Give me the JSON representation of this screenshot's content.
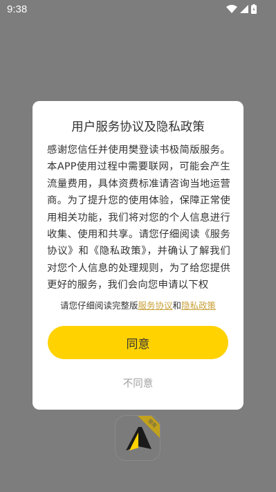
{
  "status_bar": {
    "time": "9:38",
    "icons": [
      "wifi-icon",
      "cell-signal-icon",
      "battery-icon"
    ]
  },
  "dialog": {
    "title": "用户服务协议及隐私政策",
    "body": "感谢您信任并使用樊登读书极简版服务。本APP使用过程中需要联网，可能会产生流量费用，具体资费标准请咨询当地运营商。为了提升您的使用体验，保障正常使用相关功能，我们将对您的个人信息进行收集、使用和共享。请您仔细阅读《服务协议》和《隐私政策》，并确认了解我们对您个人信息的处理规则，为了给您提供更好的服务，我们会向您申请以下权",
    "consent_prefix": "请您仔细阅读完整版",
    "service_agreement_link": "服务协议",
    "consent_and": "和",
    "privacy_policy_link": "隐私政策",
    "agree_label": "同意",
    "disagree_label": "不同意"
  },
  "app_icon": {
    "badge": "极简"
  },
  "colors": {
    "overlay": "#7d7d7d",
    "accent": "#ffd200",
    "link": "#c9a13a",
    "disagree_text": "#9e9e9e"
  }
}
